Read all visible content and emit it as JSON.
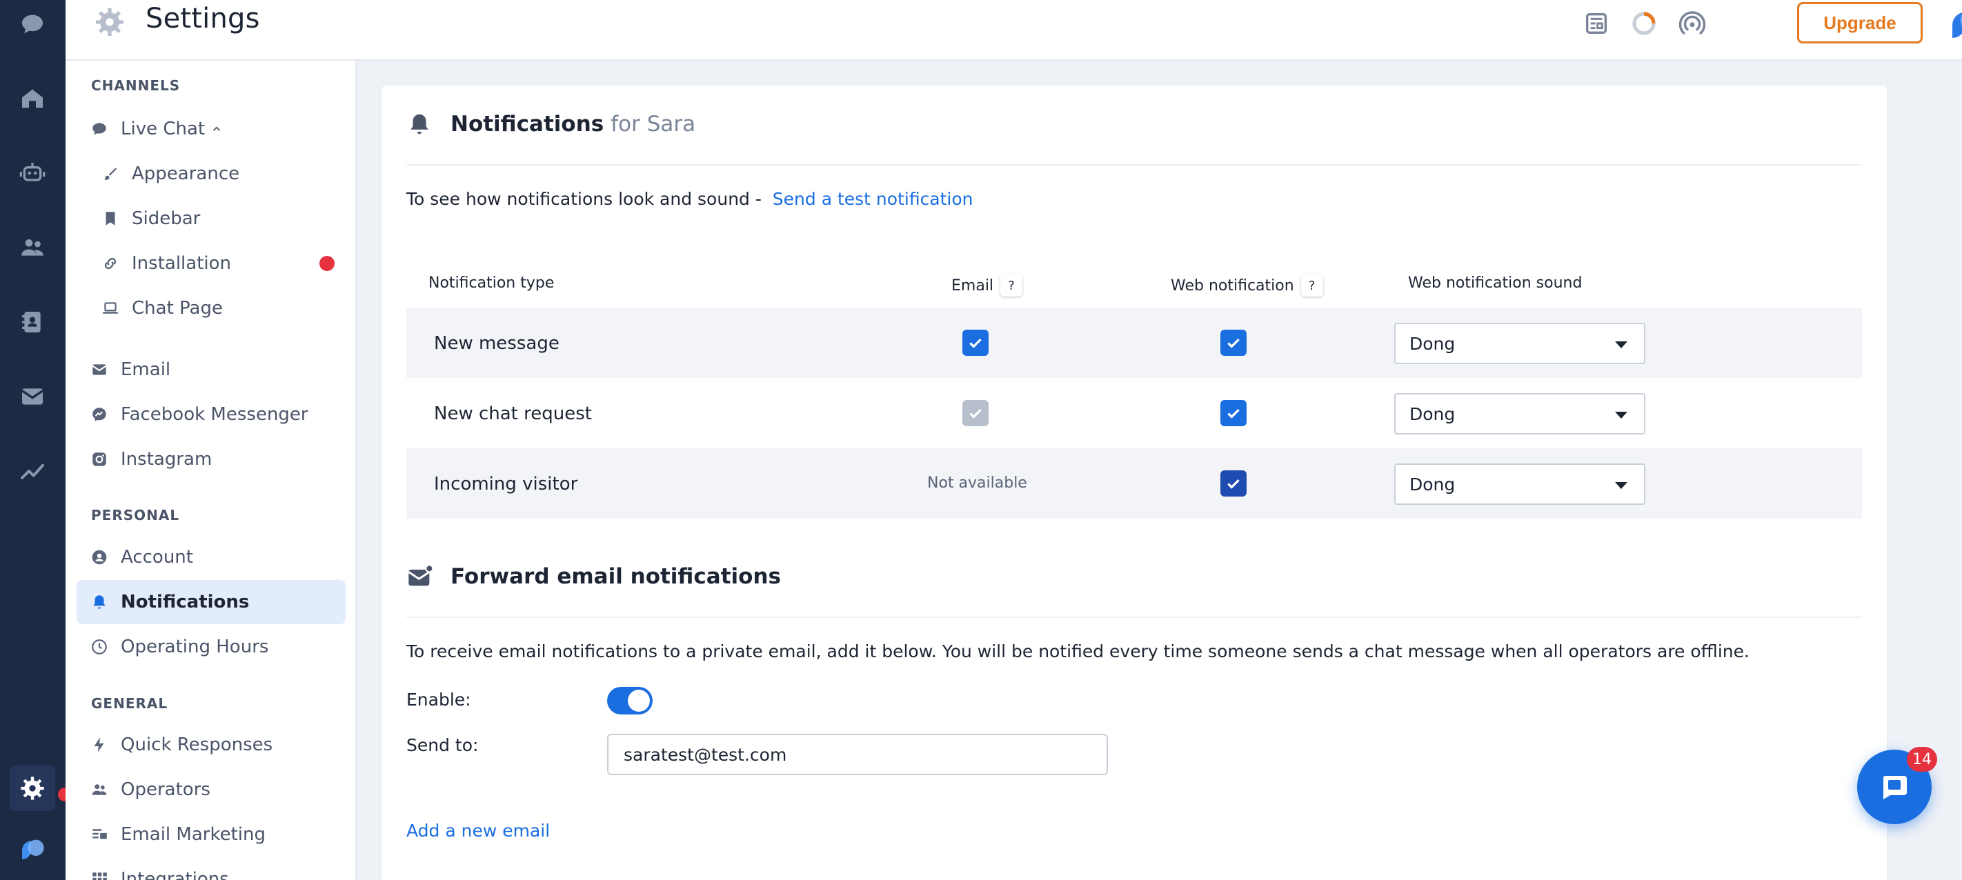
{
  "header": {
    "title": "Settings",
    "upgrade_label": "Upgrade"
  },
  "sidebar": {
    "sections": {
      "channels": "CHANNELS",
      "personal": "PERSONAL",
      "general": "GENERAL"
    },
    "items": {
      "live_chat": "Live Chat",
      "appearance": "Appearance",
      "sidebar": "Sidebar",
      "installation": "Installation",
      "chat_page": "Chat Page",
      "email": "Email",
      "facebook_messenger": "Facebook Messenger",
      "instagram": "Instagram",
      "account": "Account",
      "notifications": "Notifications",
      "operating_hours": "Operating Hours",
      "quick_responses": "Quick Responses",
      "operators": "Operators",
      "email_marketing": "Email Marketing",
      "integrations": "Integrations"
    }
  },
  "notifications": {
    "title": "Notifications",
    "for_user": "for Sara",
    "intro": "To see how notifications look and sound -",
    "test_link": "Send a test notification",
    "columns": {
      "type": "Notification type",
      "email": "Email",
      "web": "Web notification",
      "sound": "Web notification sound"
    },
    "help_mark": "?",
    "rows": [
      {
        "label": "New message",
        "email": "checked",
        "web": "checked",
        "sound": "Dong"
      },
      {
        "label": "New chat request",
        "email": "checked-disabled",
        "web": "checked",
        "sound": "Dong"
      },
      {
        "label": "Incoming visitor",
        "email_text": "Not available",
        "web": "checked",
        "sound": "Dong"
      }
    ]
  },
  "forward": {
    "title": "Forward email notifications",
    "description": "To receive email notifications to a private email, add it below. You will be notified every time someone sends a chat message when all operators are offline.",
    "enable_label": "Enable:",
    "enabled": true,
    "send_to_label": "Send to:",
    "send_to_value": "saratest@test.com",
    "add_link": "Add a new email"
  },
  "chat_widget": {
    "badge_count": "14"
  },
  "colors": {
    "accent": "#1a6ee0",
    "rail": "#1c2a43",
    "upgrade": "#e57a1f",
    "alert": "#e5323e"
  }
}
